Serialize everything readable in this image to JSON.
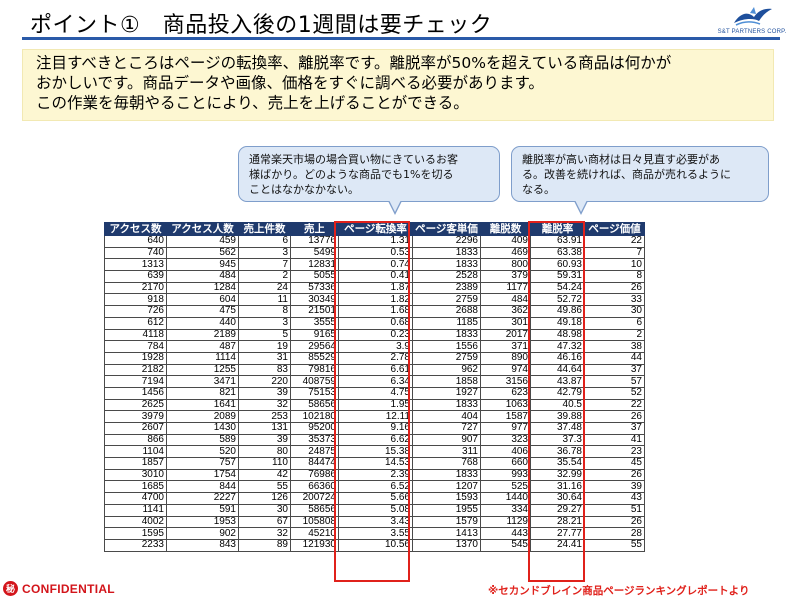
{
  "header": {
    "title": "ポイント①　商品投入後の1週間は要チェック",
    "logo_text": "S&T PARTNERS CORP."
  },
  "summary": {
    "lines": [
      "注目すべきところはページの転換率、離脱率です。離脱率が50%を超えている商品は何かが",
      "おかしいです。商品データや画像、価格をすぐに調べる必要があります。",
      "この作業を毎朝やることにより、売上を上げることができる。"
    ]
  },
  "callouts": {
    "left": [
      "通常楽天市場の場合買い物にきているお客",
      "様ばかり。どのような商品でも1%を切る",
      "ことはなかなかない。"
    ],
    "right": [
      "離脱率が高い商材は日々見直す必要があ",
      "る。改善を続ければ、商品が売れるように",
      "なる。"
    ]
  },
  "table": {
    "headers": [
      "アクセス数",
      "アクセス人数",
      "売上件数",
      "売上",
      "ページ転換率",
      "ページ客単価",
      "離脱数",
      "離脱率",
      "ページ価値"
    ],
    "rows": [
      [
        "640",
        "459",
        "6",
        "13776",
        "1.31",
        "2296",
        "409",
        "63.91",
        "22"
      ],
      [
        "740",
        "562",
        "3",
        "5499",
        "0.53",
        "1833",
        "469",
        "63.38",
        "7"
      ],
      [
        "1313",
        "945",
        "7",
        "12831",
        "0.74",
        "1833",
        "800",
        "60.93",
        "10"
      ],
      [
        "639",
        "484",
        "2",
        "5055",
        "0.41",
        "2528",
        "379",
        "59.31",
        "8"
      ],
      [
        "2170",
        "1284",
        "24",
        "57336",
        "1.87",
        "2389",
        "1177",
        "54.24",
        "26"
      ],
      [
        "918",
        "604",
        "11",
        "30349",
        "1.82",
        "2759",
        "484",
        "52.72",
        "33"
      ],
      [
        "726",
        "475",
        "8",
        "21501",
        "1.68",
        "2688",
        "362",
        "49.86",
        "30"
      ],
      [
        "612",
        "440",
        "3",
        "3555",
        "0.68",
        "1185",
        "301",
        "49.18",
        "6"
      ],
      [
        "4118",
        "2189",
        "5",
        "9165",
        "0.23",
        "1833",
        "2017",
        "48.98",
        "2"
      ],
      [
        "784",
        "487",
        "19",
        "29564",
        "3.9",
        "1556",
        "371",
        "47.32",
        "38"
      ],
      [
        "1928",
        "1114",
        "31",
        "85529",
        "2.78",
        "2759",
        "890",
        "46.16",
        "44"
      ],
      [
        "2182",
        "1255",
        "83",
        "79816",
        "6.61",
        "962",
        "974",
        "44.64",
        "37"
      ],
      [
        "7194",
        "3471",
        "220",
        "408759",
        "6.34",
        "1858",
        "3156",
        "43.87",
        "57"
      ],
      [
        "1456",
        "821",
        "39",
        "75153",
        "4.75",
        "1927",
        "623",
        "42.79",
        "52"
      ],
      [
        "2625",
        "1641",
        "32",
        "58656",
        "1.95",
        "1833",
        "1063",
        "40.5",
        "22"
      ],
      [
        "3979",
        "2089",
        "253",
        "102180",
        "12.11",
        "404",
        "1587",
        "39.88",
        "26"
      ],
      [
        "2607",
        "1430",
        "131",
        "95200",
        "9.16",
        "727",
        "977",
        "37.48",
        "37"
      ],
      [
        "866",
        "589",
        "39",
        "35373",
        "6.62",
        "907",
        "323",
        "37.3",
        "41"
      ],
      [
        "1104",
        "520",
        "80",
        "24875",
        "15.38",
        "311",
        "406",
        "36.78",
        "23"
      ],
      [
        "1857",
        "757",
        "110",
        "84474",
        "14.53",
        "768",
        "660",
        "35.54",
        "45"
      ],
      [
        "3010",
        "1754",
        "42",
        "76986",
        "2.39",
        "1833",
        "993",
        "32.99",
        "26"
      ],
      [
        "1685",
        "844",
        "55",
        "66360",
        "6.52",
        "1207",
        "525",
        "31.16",
        "39"
      ],
      [
        "4700",
        "2227",
        "126",
        "200724",
        "5.66",
        "1593",
        "1440",
        "30.64",
        "43"
      ],
      [
        "1141",
        "591",
        "30",
        "58656",
        "5.08",
        "1955",
        "334",
        "29.27",
        "51"
      ],
      [
        "4002",
        "1953",
        "67",
        "105808",
        "3.43",
        "1579",
        "1129",
        "28.21",
        "26"
      ],
      [
        "1595",
        "902",
        "32",
        "45210",
        "3.55",
        "1413",
        "443",
        "27.77",
        "28"
      ],
      [
        "2233",
        "843",
        "89",
        "121930",
        "10.56",
        "1370",
        "545",
        "24.41",
        "55"
      ]
    ]
  },
  "footer": {
    "badge": "秘",
    "confidential": "CONFIDENTIAL",
    "source": "※セカンドブレイン商品ページランキングレポートより"
  },
  "colors": {
    "accent_blue": "#2a5aa8",
    "table_header": "#1f3a6d",
    "highlight_red": "#e0211b",
    "summary_bg": "#fdf7d2",
    "callout_bg": "#dde8f6"
  },
  "icons": {
    "logo": "bird-logo-icon",
    "confidential": "secret-seal-icon"
  }
}
